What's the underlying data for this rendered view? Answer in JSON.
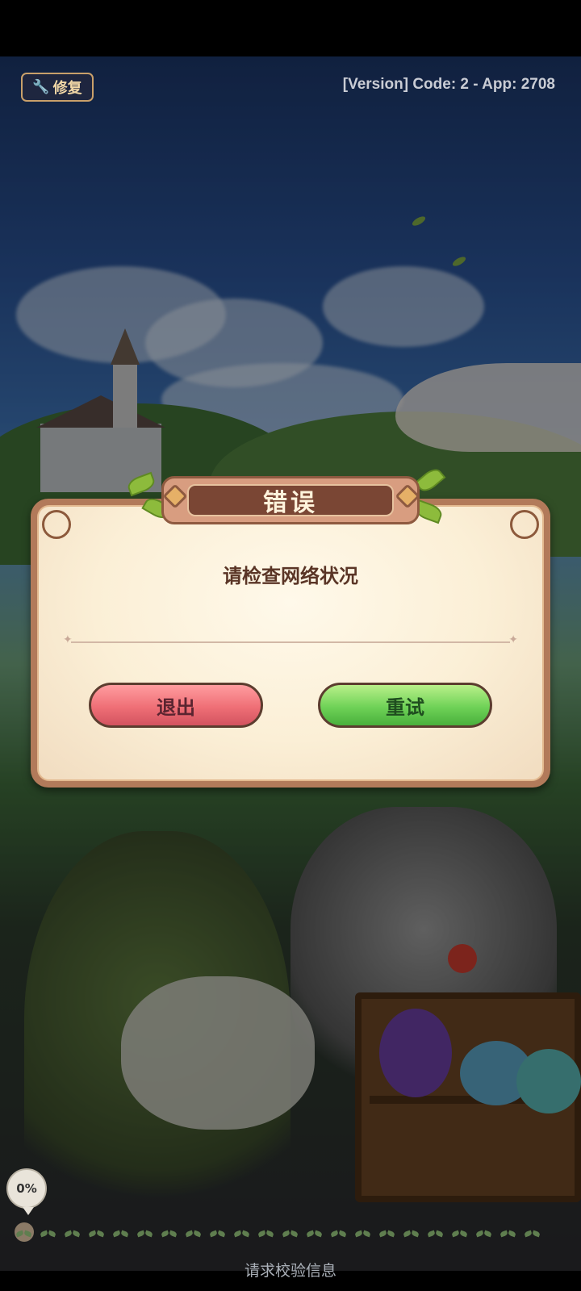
{
  "header": {
    "repair_button_label": "修复",
    "version_text": "[Version] Code: 2 - App: 2708"
  },
  "dialog": {
    "title": "错误",
    "message": "请检查网络状况",
    "exit_label": "退出",
    "retry_label": "重试"
  },
  "loading": {
    "percent_text": "0%",
    "progress": 0,
    "status_text": "请求校验信息"
  },
  "colors": {
    "exit_button": "#ef6f76",
    "retry_button": "#6fd257",
    "dialog_frame": "#b27a5a",
    "title_plate": "#7a4634"
  }
}
